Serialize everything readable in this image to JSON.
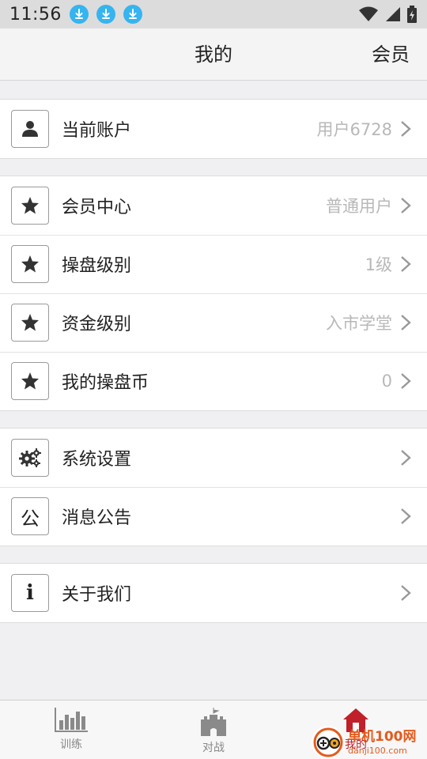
{
  "status_bar": {
    "time": "11:56"
  },
  "header": {
    "title": "我的",
    "action": "会员"
  },
  "groups": [
    {
      "items": [
        {
          "label": "当前账户",
          "value": "用户6728",
          "icon": "user-icon"
        }
      ]
    },
    {
      "items": [
        {
          "label": "会员中心",
          "value": "普通用户",
          "icon": "star-icon"
        },
        {
          "label": "操盘级别",
          "value": "1级",
          "icon": "star-icon"
        },
        {
          "label": "资金级别",
          "value": "入市学堂",
          "icon": "star-icon"
        },
        {
          "label": "我的操盘币",
          "value": "0",
          "icon": "star-icon"
        }
      ]
    },
    {
      "items": [
        {
          "label": "系统设置",
          "value": "",
          "icon": "gears-icon"
        },
        {
          "label": "消息公告",
          "value": "",
          "icon": "公"
        }
      ]
    },
    {
      "items": [
        {
          "label": "关于我们",
          "value": "",
          "icon": "info-icon"
        }
      ]
    }
  ],
  "bottom_nav": [
    {
      "label": "训练",
      "icon": "bar-chart-icon"
    },
    {
      "label": "对战",
      "icon": "castle-icon"
    },
    {
      "label": "我的",
      "icon": "home-icon",
      "active": true
    }
  ],
  "watermark": {
    "name": "单机100网",
    "url": "danji100.com"
  },
  "colors": {
    "accent": "#c0202a",
    "value_text": "#b8b8b8",
    "download_badge": "#35b4f0"
  }
}
